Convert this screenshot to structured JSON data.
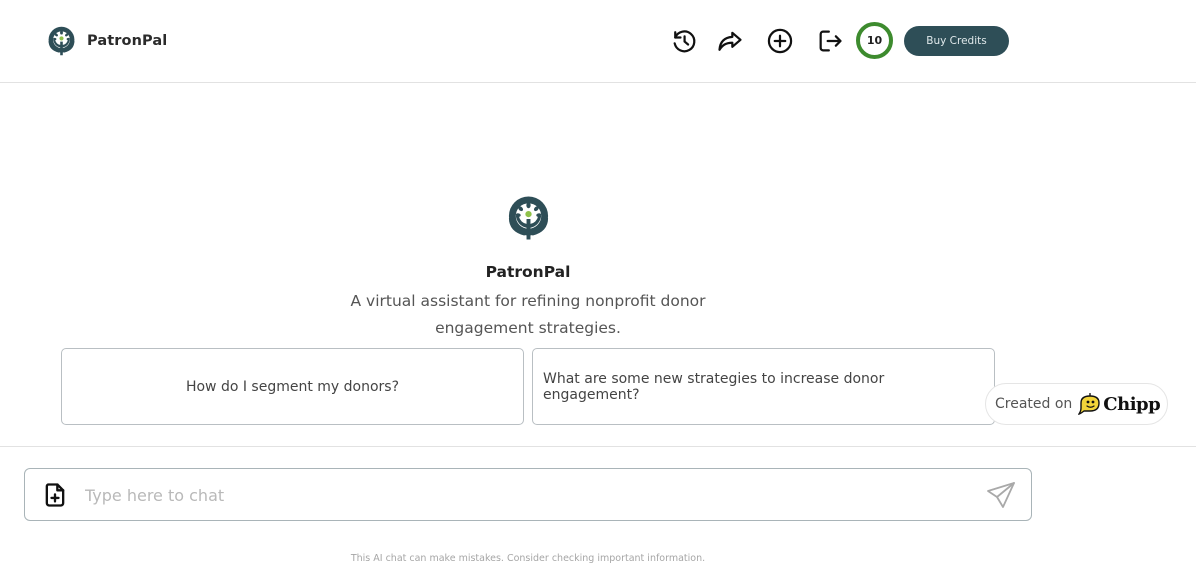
{
  "app": {
    "name": "PatronPal",
    "logo_icon": "hands-holding-sprout-logo"
  },
  "header": {
    "toolbar": {
      "history_icon": "history-icon",
      "share_icon": "share-arrow-icon",
      "new_chat_icon": "plus-circle-icon",
      "logout_icon": "logout-icon",
      "credits_remaining": "10",
      "buy_credits_label": "Buy Credits"
    }
  },
  "hero": {
    "title": "PatronPal",
    "description": "A virtual assistant for refining nonprofit donor engagement strategies."
  },
  "suggestions": [
    {
      "label": "How do I segment my donors?"
    },
    {
      "label": "What are some new strategies to increase donor engagement?"
    }
  ],
  "badge": {
    "created_on": "Created on",
    "brand": "Chipp"
  },
  "chat": {
    "placeholder": "Type here to chat",
    "value": "",
    "attach_icon": "file-plus-icon",
    "send_icon": "paper-plane-icon"
  },
  "colors": {
    "brand_dark": "#2e4e57",
    "credits_ring": "#3d8b2e",
    "logo_accent": "#8fc24a"
  },
  "footer": {
    "disclaimer": "This AI chat can make mistakes. Consider checking important information."
  }
}
